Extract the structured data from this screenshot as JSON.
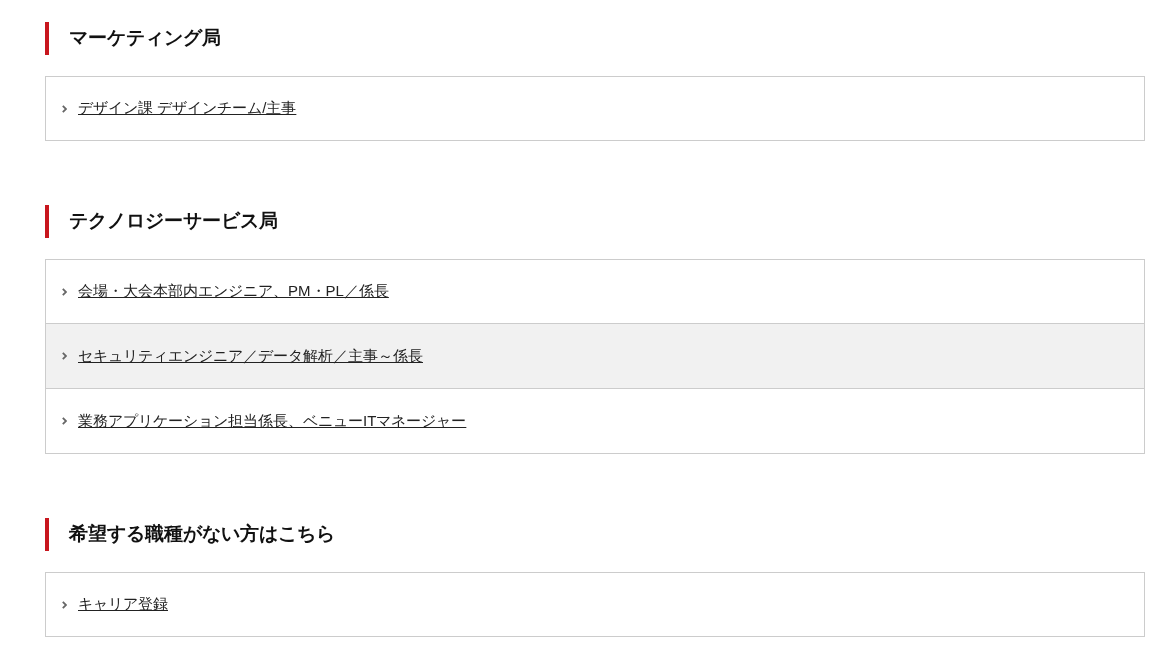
{
  "sections": [
    {
      "heading": "マーケティング局",
      "items": [
        {
          "label": "デザイン課 デザインチーム/主事",
          "highlighted": false
        }
      ]
    },
    {
      "heading": "テクノロジーサービス局",
      "items": [
        {
          "label": "会場・大会本部内エンジニア、PM・PL／係長",
          "highlighted": false
        },
        {
          "label": "セキュリティエンジニア／データ解析／主事～係長",
          "highlighted": true
        },
        {
          "label": "業務アプリケーション担当係長、ベニューITマネージャー",
          "highlighted": false
        }
      ]
    },
    {
      "heading": "希望する職種がない方はこちら",
      "items": [
        {
          "label": "キャリア登録",
          "highlighted": false
        }
      ]
    }
  ]
}
